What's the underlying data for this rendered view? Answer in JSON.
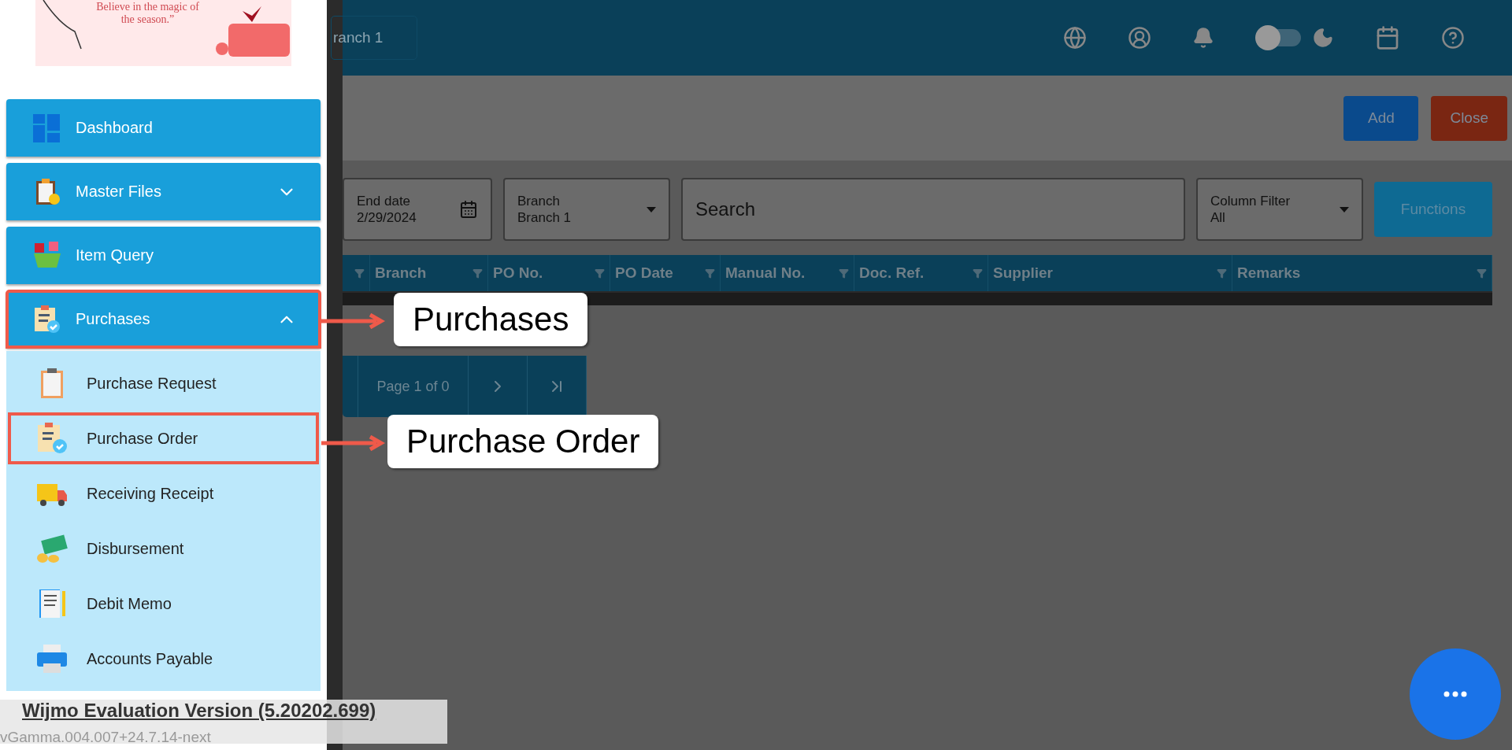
{
  "banner": {
    "quote_line_1": "Believe in the magic of",
    "quote_line_2": "the season.”"
  },
  "menu": [
    {
      "label": "Dashboard",
      "kind": "link",
      "annotated": false
    },
    {
      "label": "Master Files",
      "kind": "group",
      "expanded": false,
      "annotated": false
    },
    {
      "label": "Item Query",
      "kind": "link",
      "annotated": false
    },
    {
      "label": "Purchases",
      "kind": "group",
      "expanded": true,
      "annotated": true,
      "children": [
        {
          "label": "Purchase Request",
          "annotated": false
        },
        {
          "label": "Purchase Order",
          "annotated": true
        },
        {
          "label": "Receiving Receipt",
          "annotated": false
        },
        {
          "label": "Disbursement",
          "annotated": false
        },
        {
          "label": "Debit Memo",
          "annotated": false
        },
        {
          "label": "Accounts Payable",
          "annotated": false
        }
      ]
    }
  ],
  "top_bar": {
    "branch_button": "ranch 1",
    "dark_mode": false
  },
  "actions": [
    "Add",
    "Close"
  ],
  "filters": {
    "end_date": {
      "label": "End date",
      "value": "2/29/2024"
    },
    "branch": {
      "label": "Branch",
      "value": "Branch 1"
    },
    "search": {
      "placeholder": "Search"
    },
    "column_filter": {
      "label": "Column Filter",
      "value": "All"
    },
    "functions_button": "Functions"
  },
  "table": {
    "columns": [
      "",
      "Branch",
      "PO No.",
      "PO Date",
      "Manual No.",
      "Doc. Ref.",
      "Supplier",
      "Remarks"
    ]
  },
  "pagination": {
    "page_info": "Page 1 of 0"
  },
  "callouts": [
    {
      "text": "Purchases"
    },
    {
      "text": "Purchase Order"
    }
  ],
  "evaluation_notice": "Wijmo Evaluation Version (5.20202.699)",
  "version": "vGamma.004.007+24.7.14-next"
}
